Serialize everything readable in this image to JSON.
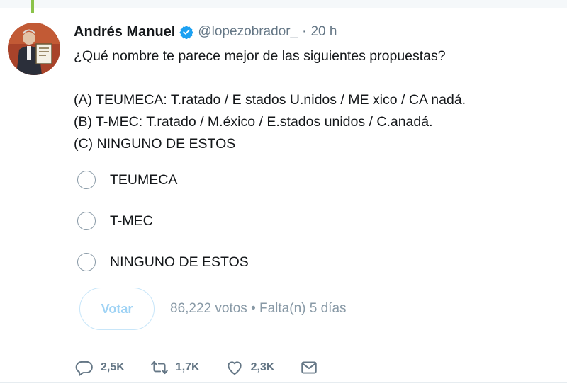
{
  "tweet": {
    "author": {
      "display_name": "Andrés Manuel",
      "handle": "@lopezobrador_",
      "separator": "·",
      "time": "20 h",
      "verified": true
    },
    "text_lines": [
      "¿Qué nombre te parece mejor de las siguientes propuestas?",
      "",
      "(A) TEUMECA: T.ratado / E stados U.nidos / ME xico / CA nadá.",
      "(B) T-MEC: T.ratado / M.éxico / E.stados unidos / C.anadá.",
      "(C) NINGUNO DE ESTOS"
    ],
    "poll": {
      "options": [
        {
          "label": "TEUMECA"
        },
        {
          "label": "T-MEC"
        },
        {
          "label": "NINGUNO DE ESTOS"
        }
      ],
      "vote_button_label": "Votar",
      "meta": "86,222 votos • Falta(n) 5 días"
    },
    "actions": {
      "reply": {
        "icon": "reply-icon",
        "count": "2,5K"
      },
      "retweet": {
        "icon": "retweet-icon",
        "count": "1,7K"
      },
      "like": {
        "icon": "heart-icon",
        "count": "2,3K"
      },
      "message": {
        "icon": "envelope-icon"
      }
    }
  },
  "colors": {
    "accent": "#1da1f2",
    "muted_text": "#657786",
    "thread_line": "#8bc34a",
    "vote_button_text": "#9fd3f5"
  }
}
